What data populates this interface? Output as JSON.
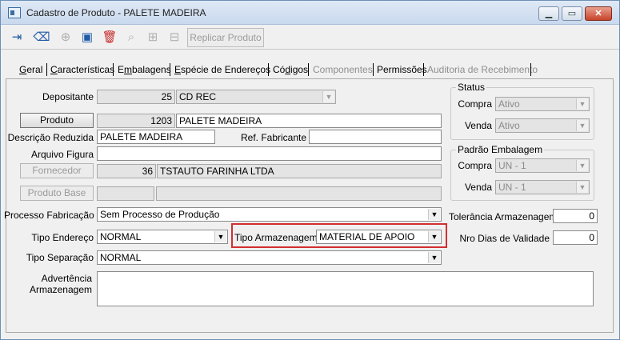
{
  "window": {
    "title": "Cadastro de Produto - PALETE MADEIRA"
  },
  "toolbar": {
    "new_icon": "enter-icon",
    "clear_icon": "eraser-icon",
    "add_icon": "plus-circle-icon",
    "save_icon": "save-icon",
    "delete_icon": "trash-icon",
    "search_icon": "magnifier-icon",
    "expand_icon": "tree-plus-icon",
    "collapse_icon": "tree-minus-icon",
    "replicar_label": "Replicar Produto"
  },
  "tabs": [
    {
      "label": "Geral",
      "accel": "e",
      "state": "active"
    },
    {
      "label": "Características",
      "accel": "C",
      "state": "enabled"
    },
    {
      "label": "Embalagens",
      "accel": "m",
      "state": "enabled"
    },
    {
      "label": "Espécie de Endereços",
      "accel": "E",
      "state": "enabled"
    },
    {
      "label": "Códigos",
      "accel": "d",
      "state": "enabled"
    },
    {
      "label": "Componentes",
      "accel": "",
      "state": "disabled"
    },
    {
      "label": "Permissões",
      "accel": "",
      "state": "enabled"
    },
    {
      "label": "Auditoria de Recebimento",
      "accel": "",
      "state": "disabled"
    }
  ],
  "form": {
    "depositante_label": "Depositante",
    "depositante_code": "25",
    "depositante_name": "CD REC",
    "produto_button": "Produto",
    "produto_code": "1203",
    "produto_name": "PALETE MADEIRA",
    "descricao_label": "Descrição Reduzida",
    "descricao_value": "PALETE MADEIRA",
    "ref_fabricante_label": "Ref. Fabricante",
    "ref_fabricante_value": "",
    "arquivo_figura_label": "Arquivo Figura",
    "arquivo_figura_value": "",
    "fornecedor_button": "Fornecedor",
    "fornecedor_code": "36",
    "fornecedor_name": "TSTAUTO FARINHA LTDA",
    "produto_base_button": "Produto Base",
    "processo_label": "Processo Fabricação",
    "processo_value": "Sem Processo de Produção",
    "tipo_endereco_label": "Tipo Endereço",
    "tipo_endereco_value": "NORMAL",
    "tipo_armazenagem_label": "Tipo Armazenagem",
    "tipo_armazenagem_value": "MATERIAL DE APOIO",
    "tipo_separacao_label": "Tipo Separação",
    "tipo_separacao_value": "NORMAL",
    "advertencia_label_1": "Advertência",
    "advertencia_label_2": "Armazenagem",
    "tolerancia_label": "Tolerância Armazenagem",
    "tolerancia_value": "0",
    "nro_dias_label": "Nro Dias de Validade",
    "nro_dias_value": "0"
  },
  "status": {
    "title": "Status",
    "compra_label": "Compra",
    "compra_value": "Ativo",
    "venda_label": "Venda",
    "venda_value": "Ativo"
  },
  "padrao": {
    "title": "Padrão Embalagem",
    "compra_label": "Compra",
    "compra_value": "UN - 1",
    "venda_label": "Venda",
    "venda_value": "UN - 1"
  },
  "colors": {
    "highlight": "#d32f2f",
    "title_bar": "#c9d9ee"
  }
}
